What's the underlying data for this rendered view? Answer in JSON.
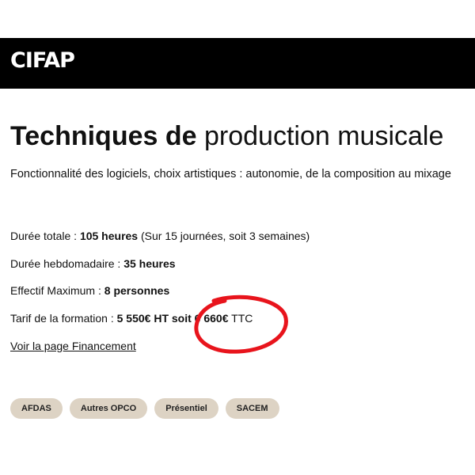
{
  "header": {
    "logo": "CIFAP",
    "background": "#000000"
  },
  "course": {
    "title_bold": "Techniques de",
    "title_light": "production musicale",
    "subtitle": "Fonctionnalité des logiciels, choix artistiques : autonomie, de la composition au mixage"
  },
  "details": {
    "duration_total": {
      "label": "Durée totale : ",
      "value": "105 heures",
      "note": " (Sur 15 journées, soit 3 semaines)"
    },
    "duration_weekly": {
      "label": "Durée hebdomadaire : ",
      "value": "35 heures"
    },
    "capacity": {
      "label": "Effectif Maximum : ",
      "value": "8 personnes"
    },
    "price": {
      "label": "Tarif de la formation : ",
      "value_ht": "5 550€ HT",
      "middle": " soit ",
      "value_ttc": "6 660€",
      "suffix": " TTC"
    }
  },
  "financing_link": "Voir la page Financement",
  "tags": [
    "AFDAS",
    "Autres OPCO",
    "Présentiel",
    "SACEM"
  ],
  "colors": {
    "tag_background": "#ddd3c4",
    "annotation": "#e8141c"
  }
}
